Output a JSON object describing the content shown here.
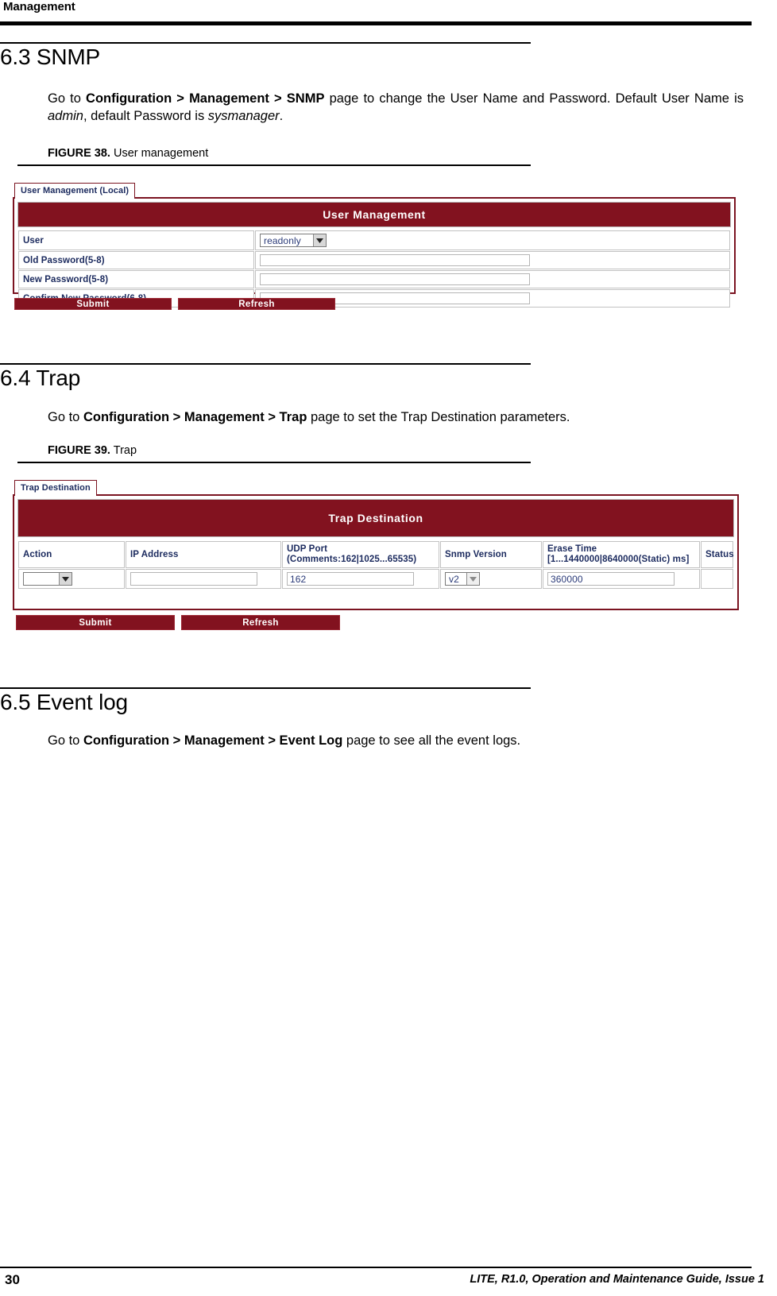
{
  "page": {
    "running_head": "Management",
    "footer_page_number": "30",
    "footer_text": "LITE, R1.0, Operation and Maintenance Guide, Issue 1"
  },
  "sections": [
    {
      "number_title": "6.3 SNMP",
      "paragraph": {
        "lead": "Go to ",
        "path": "Configuration > Management > SNMP",
        "mid": " page to change the User Name and Password. Default User Name is ",
        "em1": "admin",
        "mid2": ", default Password is ",
        "em2": "sysmanager",
        "tail": "."
      },
      "figure": {
        "label": "FIGURE 38.",
        "title": "User management"
      }
    },
    {
      "number_title": "6.4 Trap",
      "paragraph": {
        "lead": "Go to ",
        "path": "Configuration > Management > Trap",
        "tail": " page to set the Trap Destination parameters."
      },
      "figure": {
        "label": "FIGURE 39.",
        "title": "Trap"
      }
    },
    {
      "number_title": "6.5 Event log",
      "paragraph": {
        "lead": "Go to ",
        "path": "Configuration > Management > Event Log",
        "tail": " page to see all the event logs."
      }
    }
  ],
  "user_management_ui": {
    "tab_label": "User Management (Local)",
    "banner_title": "User Management",
    "rows": [
      {
        "label": "User",
        "control": "select",
        "value": "readonly"
      },
      {
        "label": "Old Password(5-8)",
        "control": "text",
        "value": ""
      },
      {
        "label": "New Password(5-8)",
        "control": "text",
        "value": ""
      },
      {
        "label": "Confirm New Password(6-8)",
        "control": "text",
        "value": ""
      }
    ],
    "buttons": {
      "submit": "Submit",
      "refresh": "Refresh"
    }
  },
  "trap_ui": {
    "tab_label": "Trap Destination",
    "banner_title": "Trap Destination",
    "columns": [
      {
        "line1": "Action",
        "line2": ""
      },
      {
        "line1": "IP Address",
        "line2": ""
      },
      {
        "line1": "UDP Port",
        "line2": "(Comments:162|1025...65535)"
      },
      {
        "line1": "Snmp Version",
        "line2": ""
      },
      {
        "line1": "Erase Time",
        "line2": "[1...1440000|8640000(Static) ms]"
      },
      {
        "line1": "Status",
        "line2": ""
      }
    ],
    "row": {
      "action": "",
      "ip_address": "",
      "udp_port": "162",
      "snmp_version": "v2",
      "erase_time": "360000",
      "status": ""
    },
    "buttons": {
      "submit": "Submit",
      "refresh": "Refresh"
    }
  },
  "colors": {
    "banner_red": "#82121f",
    "tab_border_red": "#7b1421",
    "label_blue": "#1b2a5e"
  }
}
